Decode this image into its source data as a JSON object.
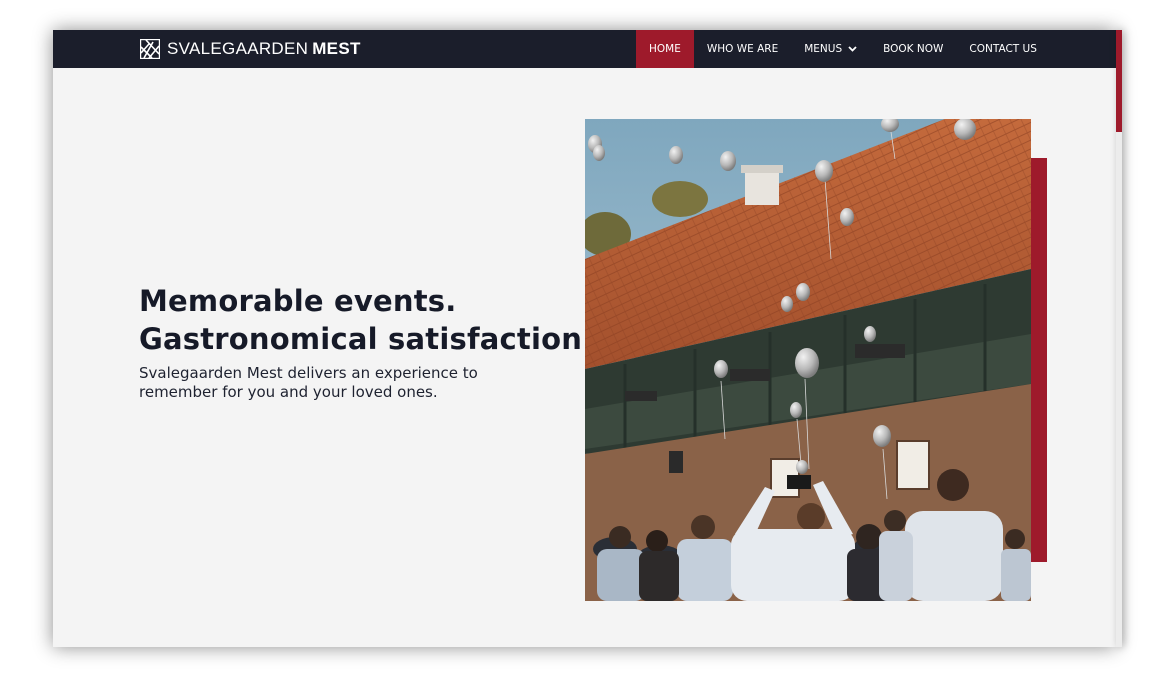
{
  "brand": {
    "name_light": "SVALEGAARDEN",
    "name_bold": "MEST",
    "logo_icon": "svalegaarden-logo-icon"
  },
  "nav": {
    "items": [
      {
        "label": "HOME",
        "active": true
      },
      {
        "label": "WHO WE ARE",
        "active": false
      },
      {
        "label": "MENUS",
        "active": false,
        "has_dropdown": true
      },
      {
        "label": "BOOK NOW",
        "active": false
      },
      {
        "label": "CONTACT US",
        "active": false
      }
    ]
  },
  "hero": {
    "title_line1": "Memorable events.",
    "title_line2": "Gastronomical satisfaction.",
    "subtitle": "Svalegaarden Mest delivers an experience to remember for you and your loved ones.",
    "image_subject": "guests releasing balloons in front of a tiled-roof building"
  },
  "colors": {
    "accent": "#9e1a2b",
    "navbar": "#1b1e2b",
    "page_background": "#f4f4f4",
    "heading": "#161a28"
  }
}
